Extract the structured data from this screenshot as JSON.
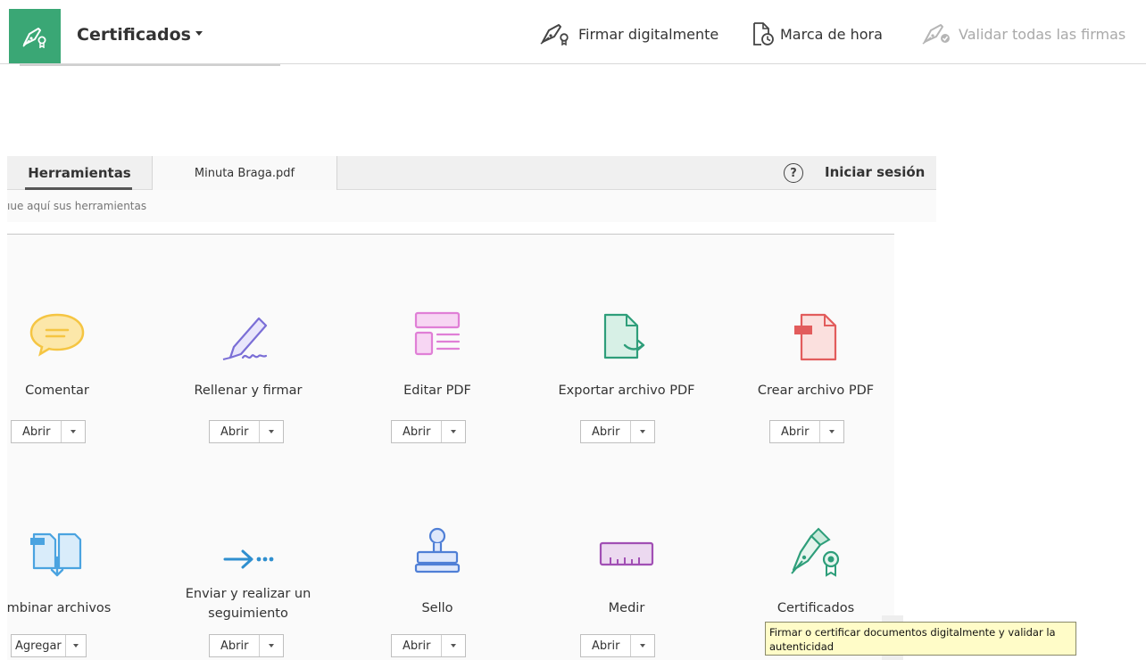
{
  "cert_toolbar": {
    "title": "Certificados",
    "actions": [
      {
        "label": "Firmar digitalmente",
        "icon": "pen-seal-icon",
        "enabled": true
      },
      {
        "label": "Marca de hora",
        "icon": "timestamp-icon",
        "enabled": true
      },
      {
        "label": "Validar todas las firmas",
        "icon": "validate-signatures-icon",
        "enabled": false
      }
    ]
  },
  "tabs": {
    "tools": "Herramientas",
    "document": "Minuta Braga.pdf",
    "help": "?",
    "signin": "Iniciar sesión"
  },
  "search": {
    "placeholder": "ıue aquí sus herramientas"
  },
  "tools": [
    {
      "label": "Comentar",
      "button": "Abrir",
      "icon": "comment-icon"
    },
    {
      "label": "Rellenar y firmar",
      "button": "Abrir",
      "icon": "fill-sign-icon"
    },
    {
      "label": "Editar PDF",
      "button": "Abrir",
      "icon": "edit-pdf-icon"
    },
    {
      "label": "Exportar archivo PDF",
      "button": "Abrir",
      "icon": "export-pdf-icon"
    },
    {
      "label": "Crear archivo PDF",
      "button": "Abrir",
      "icon": "create-pdf-icon"
    },
    {
      "label": "mbinar archivos",
      "button": "Agregar",
      "icon": "combine-files-icon"
    },
    {
      "label": "Enviar y realizar un seguimiento",
      "button": "Abrir",
      "icon": "send-track-icon"
    },
    {
      "label": "Sello",
      "button": "Abrir",
      "icon": "stamp-icon"
    },
    {
      "label": "Medir",
      "button": "Abrir",
      "icon": "measure-icon"
    },
    {
      "label": "Certificados",
      "button": "",
      "icon": "certificates-icon"
    }
  ],
  "tooltip": "Firmar o certificar documentos digitalmente y validar la autenticidad",
  "colors": {
    "cert_green": "#3aa775",
    "comment_yellow": "#f5c542",
    "fill_sign_purple": "#7a6ed6",
    "edit_pink": "#e07fd6",
    "export_green": "#2e9e7a",
    "create_red": "#e25c5c",
    "combine_blue": "#4aa3e0",
    "send_blue": "#2f8fcf",
    "stamp_blue": "#4f7fd6",
    "measure_purple": "#a14fb4",
    "tooltip_bg": "#fffcc8"
  }
}
